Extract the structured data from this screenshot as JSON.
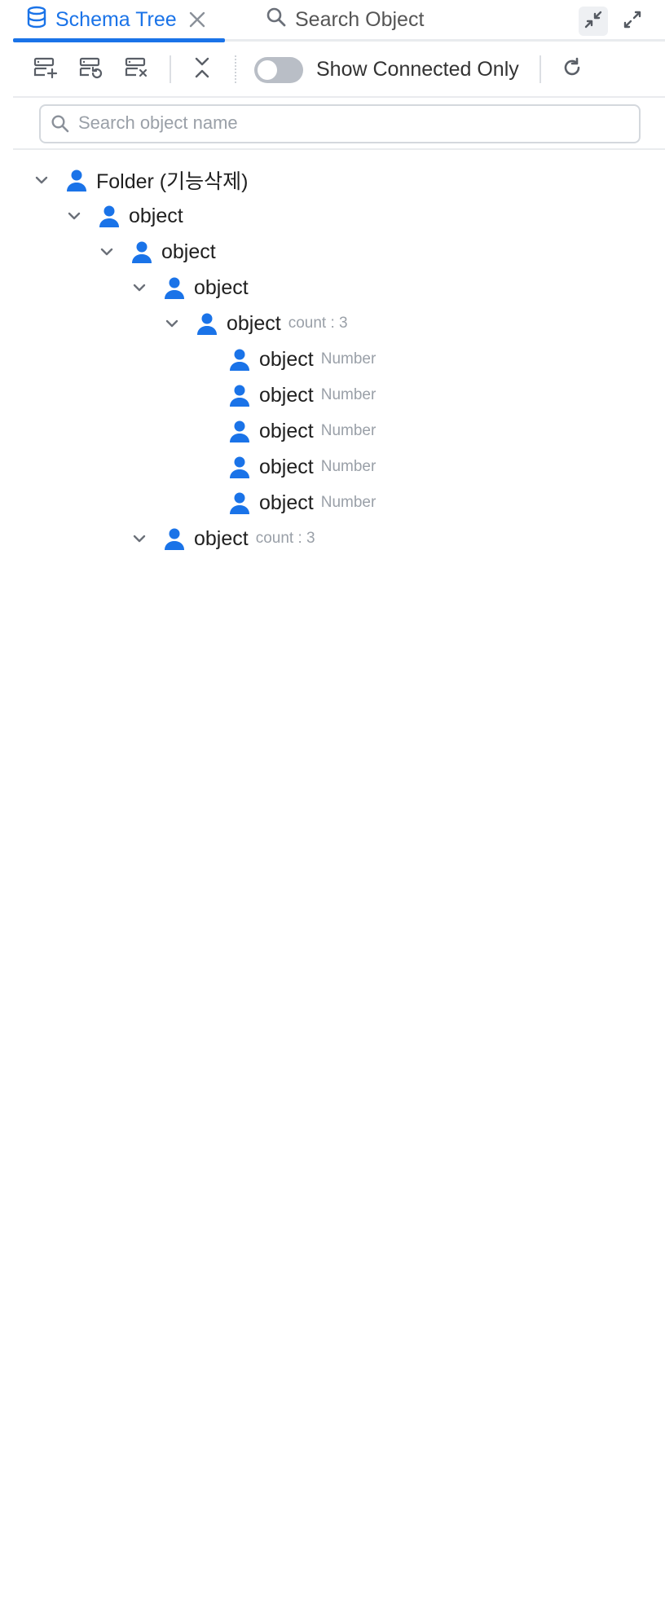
{
  "tabs": {
    "schema_tree": {
      "label": "Schema Tree",
      "icon": "database-icon"
    },
    "search_object": {
      "label": "Search Object",
      "icon": "search-icon"
    }
  },
  "window_controls": {
    "collapse_icon": "collapse-arrows-icon",
    "expand_icon": "expand-arrows-icon"
  },
  "toolbar": {
    "buttons": [
      "add-item-icon",
      "restore-item-icon",
      "remove-item-icon",
      "collapse-all-icon"
    ],
    "toggle": {
      "label": "Show Connected Only",
      "on": false
    },
    "refresh_icon": "refresh-icon"
  },
  "search": {
    "placeholder": "Search object name",
    "value": ""
  },
  "tree": {
    "root": {
      "label": "Folder (기능삭제)"
    },
    "n1": {
      "label": "object"
    },
    "n2": {
      "label": "object"
    },
    "n3": {
      "label": "object"
    },
    "n4": {
      "label": "object",
      "meta": "count : 3"
    },
    "leaves": [
      {
        "label": "object",
        "meta": "Number"
      },
      {
        "label": "object",
        "meta": "Number"
      },
      {
        "label": "object",
        "meta": "Number"
      },
      {
        "label": "object",
        "meta": "Number"
      },
      {
        "label": "object",
        "meta": "Number"
      }
    ],
    "n5": {
      "label": "object",
      "meta": "count : 3"
    }
  },
  "colors": {
    "accent": "#1a73e8",
    "toggle_off": "#b9bec6",
    "muted_text": "#9aa0a8"
  }
}
